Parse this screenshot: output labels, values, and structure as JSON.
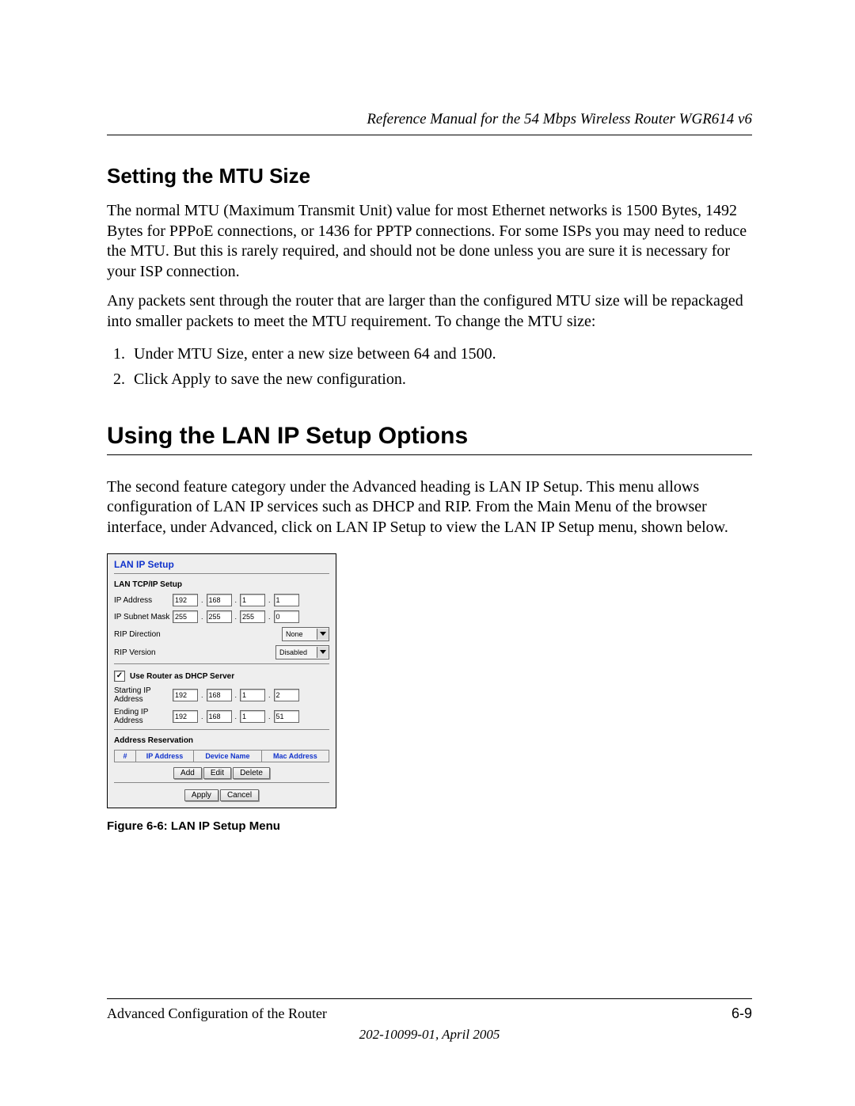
{
  "header": {
    "manual_title": "Reference Manual for the 54 Mbps Wireless Router WGR614 v6"
  },
  "section_mtu": {
    "heading": "Setting the MTU Size",
    "p1": "The normal MTU (Maximum Transmit Unit) value for most Ethernet networks is 1500 Bytes, 1492 Bytes for PPPoE connections, or 1436 for PPTP connections. For some ISPs you may need to reduce the MTU. But this is rarely required, and should not be done unless you are sure it is necessary for your ISP connection.",
    "p2": "Any packets sent through the router that are larger than the configured MTU size will be repackaged into smaller packets to meet the MTU requirement. To change the MTU size:",
    "steps": [
      "Under MTU Size, enter a new size between 64 and 1500.",
      "Click Apply to save the new configuration."
    ]
  },
  "section_lan": {
    "heading": "Using the LAN IP Setup Options",
    "p1": "The second feature category under the Advanced heading is LAN IP Setup. This menu allows configuration of LAN IP services such as DHCP and RIP. From the Main Menu of the browser interface, under Advanced, click on LAN IP Setup to view the LAN IP Setup menu, shown below.",
    "figure_caption": "Figure 6-6:  LAN IP Setup Menu"
  },
  "panel": {
    "title": "LAN IP Setup",
    "tcpip_heading": "LAN TCP/IP Setup",
    "ip_address_label": "IP Address",
    "ip_address": [
      "192",
      "168",
      "1",
      "1"
    ],
    "subnet_label": "IP Subnet Mask",
    "subnet": [
      "255",
      "255",
      "255",
      "0"
    ],
    "rip_dir_label": "RIP Direction",
    "rip_dir_value": "None",
    "rip_ver_label": "RIP Version",
    "rip_ver_value": "Disabled",
    "dhcp_checkbox_label": "Use Router as DHCP Server",
    "dhcp_checked": true,
    "start_ip_label": "Starting IP Address",
    "start_ip": [
      "192",
      "168",
      "1",
      "2"
    ],
    "end_ip_label": "Ending IP Address",
    "end_ip": [
      "192",
      "168",
      "1",
      "51"
    ],
    "addr_res_heading": "Address Reservation",
    "table_headers": {
      "num": "#",
      "ip": "IP Address",
      "dev": "Device Name",
      "mac": "Mac Address"
    },
    "buttons": {
      "add": "Add",
      "edit": "Edit",
      "delete": "Delete",
      "apply": "Apply",
      "cancel": "Cancel"
    }
  },
  "footer": {
    "chapter": "Advanced Configuration of the Router",
    "page": "6-9",
    "doc_id": "202-10099-01, April 2005"
  }
}
